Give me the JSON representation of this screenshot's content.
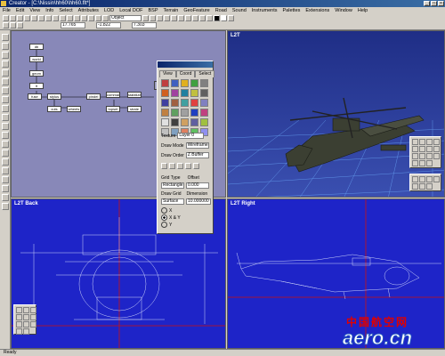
{
  "app": {
    "title": "Creator - [C:\\Nissin\\hh60\\hh60.flt*]"
  },
  "window_buttons": [
    "_",
    "□",
    "×"
  ],
  "menu": [
    "File",
    "Edit",
    "View",
    "Info",
    "Select",
    "Attributes",
    "LOD",
    "Local DOF",
    "BSP",
    "Terrain",
    "GeoFeature",
    "Road",
    "Sound",
    "Instruments",
    "Palettes",
    "Extensions",
    "Window",
    "Help"
  ],
  "toolbar": {
    "object_field": "Object",
    "x_value": "17.765",
    "y_value": "-1.822",
    "z_value": "7.303"
  },
  "hierarchy": {
    "nodes": [
      "db",
      "world",
      "geom",
      "lt",
      "fuse",
      "stylus",
      "pindel",
      "commands",
      "stabilizer",
      "cuts",
      "wheels",
      "topset",
      "strate"
    ]
  },
  "viewports": {
    "top_right": "L2T",
    "bottom_left": "L2T Back",
    "bottom_right": "L2T Right"
  },
  "palette": {
    "tabs": [
      "View",
      "Coord",
      "Select"
    ],
    "texture_label": "Texture",
    "texture_value": "Layer 0",
    "draw_mode_label": "Draw Mode",
    "draw_mode_value": "Wireframe",
    "draw_order_label": "Draw Order",
    "draw_order_value": "Z Buffer",
    "grid_type_label": "Grid Type",
    "offset_label": "Offset",
    "grid_type_value": "Rectangle",
    "offset_value": "0.000",
    "draw_grid_label": "Draw Grid",
    "dimension_label": "Dimension",
    "draw_grid_value": "Surface",
    "dimension_value": "10.000000",
    "axis_options": [
      "X",
      "X & Y",
      "Y"
    ]
  },
  "status": {
    "text": "Ready"
  },
  "watermark": {
    "cn": "中国航空网",
    "en": "aero.cn"
  },
  "colors": {
    "viewport_bg": "#8888b8",
    "perspective_sky": "#2a3d8f",
    "ortho_bg": "#1e24c8",
    "accent_red": "#cc1010"
  }
}
